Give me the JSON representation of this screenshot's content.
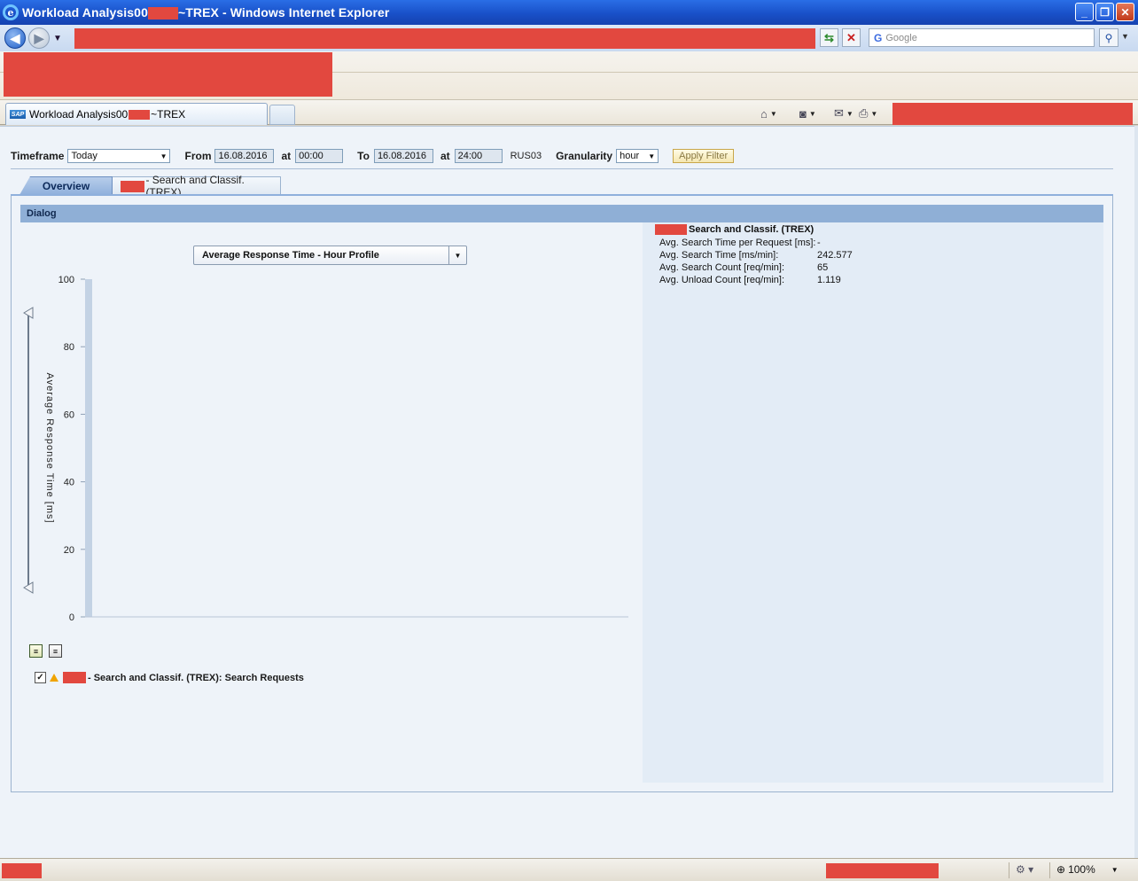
{
  "window": {
    "title_prefix": "Workload Analysis00",
    "title_suffix": "~TREX - Windows Internet Explorer",
    "minimize": "_",
    "restore": "❐",
    "close": "✕"
  },
  "address_bar": {
    "search_placeholder": "Google"
  },
  "browser_tab": {
    "label_prefix": "Workload Analysis00",
    "label_suffix": "~TREX",
    "favicon": "SAP"
  },
  "filter": {
    "timeframe_label": "Timeframe",
    "timeframe_value": "Today",
    "from_label": "From",
    "from_date": "16.08.2016",
    "at_label": "at",
    "from_time": "00:00",
    "to_label": "To",
    "to_date": "16.08.2016",
    "to_time": "24:00",
    "system_id": "RUS03",
    "granularity_label": "Granularity",
    "granularity_value": "hour",
    "apply_label": "Apply Filter"
  },
  "tabs": [
    {
      "label": "Overview"
    },
    {
      "label": "- Search and Classif. (TREX)"
    }
  ],
  "dialog": {
    "header": "Dialog",
    "chart_selector": "Average Response Time - Hour Profile",
    "legend_label": "- Search and Classif. (TREX): Search Requests"
  },
  "info": {
    "title": "Search and Classif. (TREX)",
    "rows": [
      {
        "key": "Avg. Search Time per Request [ms]:",
        "value": "-"
      },
      {
        "key": "Avg. Search Time [ms/min]:",
        "value": "242.577"
      },
      {
        "key": "Avg. Search Count [req/min]:",
        "value": "65"
      },
      {
        "key": "Avg. Unload Count [req/min]:",
        "value": "1.119"
      }
    ]
  },
  "status": {
    "zoom": "100%"
  },
  "chart_data": {
    "type": "bar",
    "ylabel": "Average Response Time [ms]",
    "ylim": [
      0,
      100
    ],
    "yticks": [
      "100",
      "80",
      "60",
      "40",
      "20",
      "0"
    ],
    "series": []
  },
  "colors": {
    "redaction": "#e2483f",
    "accent": "#8fafd6"
  }
}
